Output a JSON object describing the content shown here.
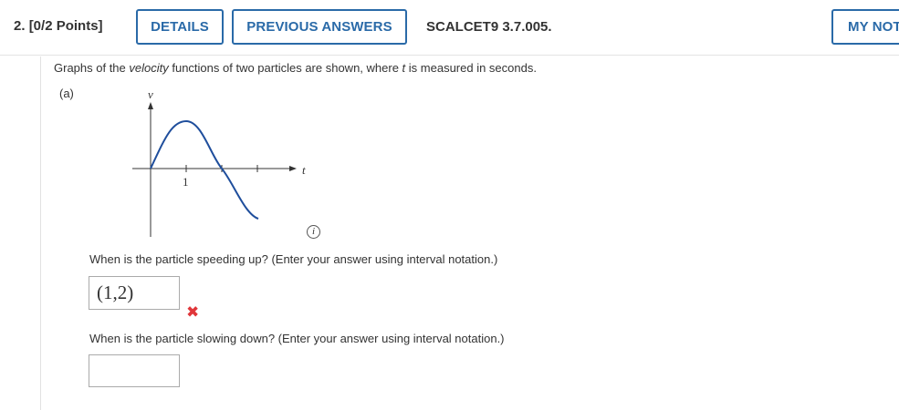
{
  "header": {
    "question_number": "2.",
    "points": "[0/2 Points]",
    "details_label": "DETAILS",
    "previous_answers_label": "PREVIOUS ANSWERS",
    "assignment_id": "SCALCET9 3.7.005.",
    "my_notes_label": "MY NOTES"
  },
  "prompt": {
    "before_italic": "Graphs of the ",
    "italic_word": "velocity",
    "middle": " functions of two particles are shown, where ",
    "italic_var": "t",
    "after": " is measured in seconds."
  },
  "part": {
    "label": "(a)"
  },
  "graph": {
    "y_axis_label": "v",
    "x_axis_label": "t",
    "x_tick_label": "1"
  },
  "info_icon": {
    "glyph": "i"
  },
  "questions": [
    {
      "text": "When is the particle speeding up? (Enter your answer using interval notation.)",
      "answer": "(1,2)",
      "status": "incorrect",
      "status_glyph": "✖"
    },
    {
      "text": "When is the particle slowing down? (Enter your answer using interval notation.)",
      "answer": ""
    }
  ],
  "colors": {
    "accent": "#2a6aa8",
    "curve": "#1f4e9c",
    "incorrect": "#e0363a"
  },
  "icons": [
    "info-icon",
    "incorrect-x-icon",
    "axis-arrow-icon"
  ]
}
